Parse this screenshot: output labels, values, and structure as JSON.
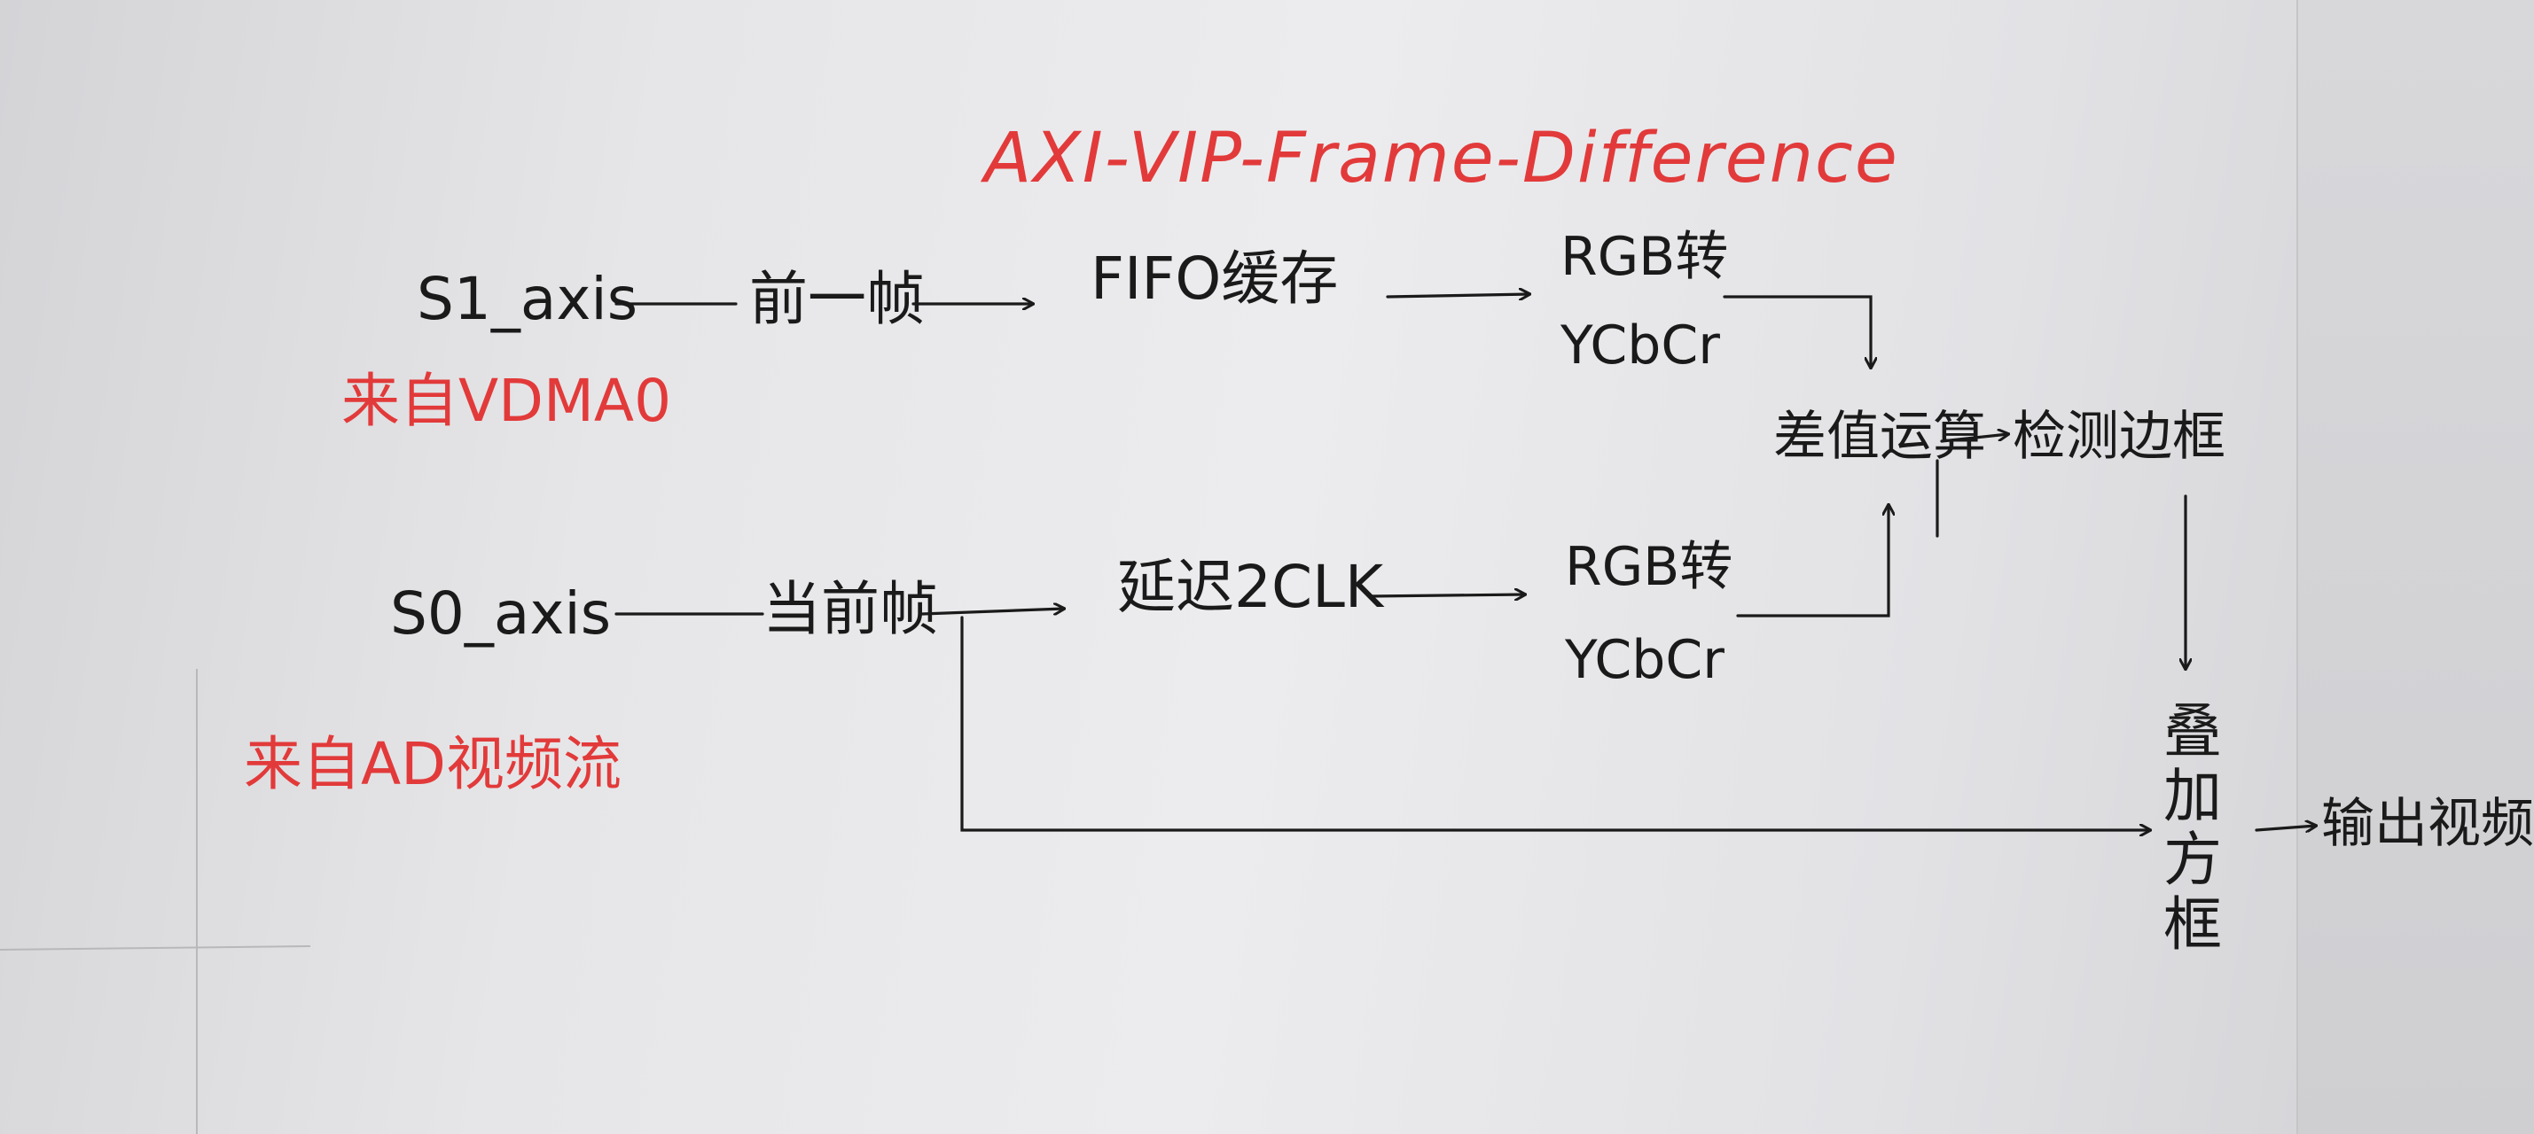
{
  "title": "AXI-VIP-Frame-Difference",
  "nodes": {
    "s1_axis": "S1_axis",
    "prev_frame": "前一帧",
    "fifo": "FIFO缓存",
    "rgb_top_line1": "RGB转",
    "rgb_top_line2": "YCbCr",
    "s0_axis": "S0_axis",
    "cur_frame": "当前帧",
    "delay": "延迟2CLK",
    "rgb_bot_line1": "RGB转",
    "rgb_bot_line2": "YCbCr",
    "diff": "差值运算",
    "detect": "检测边框",
    "overlay": [
      "叠",
      "加",
      "方",
      "框"
    ],
    "output": "输出视频"
  },
  "annotations": {
    "from_vdma": "来自VDMA0",
    "from_camera": "来自AD视频流"
  },
  "colors": {
    "ink": "#1a1a1a",
    "red_ink": "#e23a3a",
    "paper": "#ececee"
  }
}
